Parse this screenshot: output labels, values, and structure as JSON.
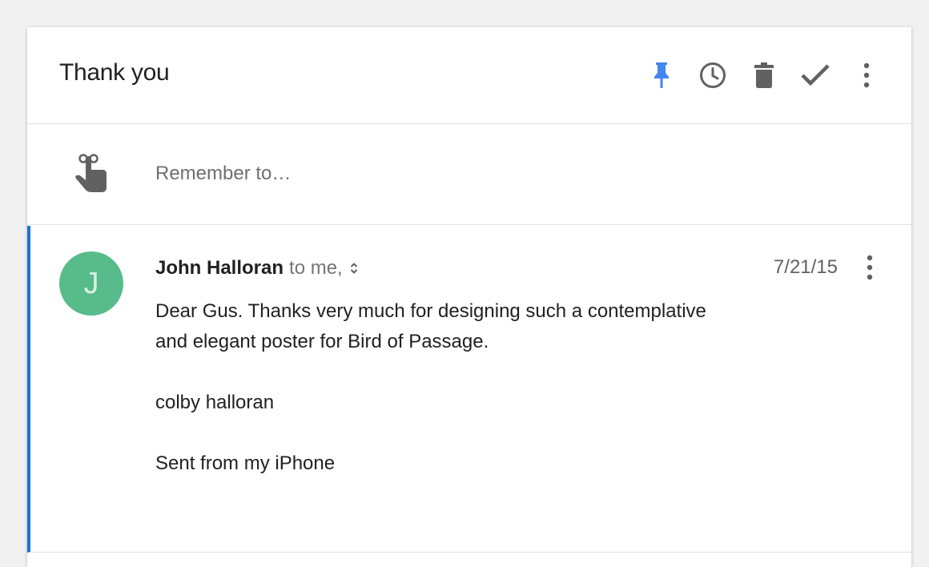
{
  "thread": {
    "subject": "Thank you"
  },
  "toolbar": {
    "pin_icon": "pin-icon",
    "snooze_icon": "clock-icon",
    "delete_icon": "trash-icon",
    "done_icon": "check-icon",
    "more_icon": "more-vert-icon",
    "pin_color": "#4285f4",
    "icon_color": "#616161"
  },
  "reminder": {
    "icon": "finger-string-reminder-icon",
    "placeholder": "Remember to…"
  },
  "message": {
    "avatar_letter": "J",
    "avatar_color": "#57bb8a",
    "sender": "John Halloran",
    "recipients": "to me,",
    "date": "7/21/15",
    "accent_color": "#1a73d4",
    "body": {
      "line1": "Dear Gus.  Thanks very much for designing such a contemplative",
      "line2": "and elegant poster for Bird of Passage.",
      "signature": "colby halloran",
      "footer": "Sent from my iPhone"
    }
  }
}
